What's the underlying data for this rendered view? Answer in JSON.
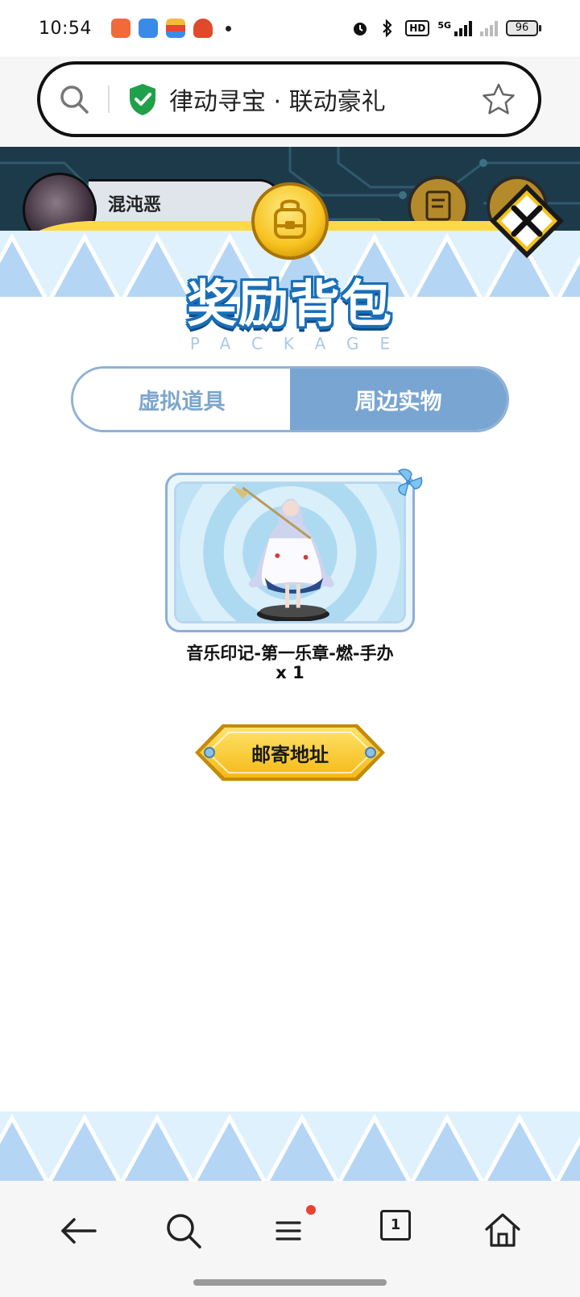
{
  "status_bar": {
    "time": "10:54",
    "network": "5G",
    "hd_label": "HD",
    "battery": "96"
  },
  "browser": {
    "page_title": "律动寻宝 · 联动豪礼",
    "tab_count": "1"
  },
  "game": {
    "player_name": "混沌恶"
  },
  "panel": {
    "title": "奖励背包",
    "subtitle": "PACKAGE",
    "tabs": [
      {
        "label": "虚拟道具",
        "active": false
      },
      {
        "label": "周边实物",
        "active": true
      }
    ],
    "item": {
      "name": "音乐印记-第一乐章-燃-手办",
      "quantity": "x 1"
    },
    "mail_button": "邮寄地址"
  },
  "colors": {
    "panel_blue": "#79a5d3",
    "gold": "#f6c21a",
    "dark_bg": "#1d3a4a"
  }
}
